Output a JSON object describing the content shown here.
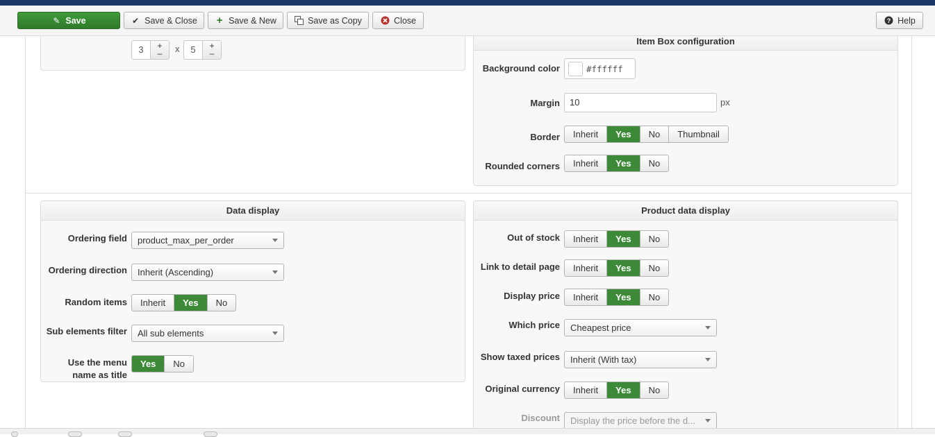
{
  "toolbar": {
    "save": "Save",
    "save_close": "Save & Close",
    "save_new": "Save & New",
    "save_copy": "Save as Copy",
    "close": "Close",
    "help": "Help"
  },
  "top_panel": {
    "rows_value": "3",
    "cols_value": "5",
    "times": "x",
    "plus": "+",
    "minus": "–"
  },
  "item_box": {
    "title": "Item Box configuration",
    "background_color_label": "Background color",
    "background_color_value": "#ffffff",
    "margin_label": "Margin",
    "margin_value": "10",
    "margin_unit": "px",
    "border_label": "Border",
    "border_options": [
      "Inherit",
      "Yes",
      "No",
      "Thumbnail"
    ],
    "border_selected": "Yes",
    "rounded_label": "Rounded corners",
    "rounded_options": [
      "Inherit",
      "Yes",
      "No"
    ],
    "rounded_selected": "Yes"
  },
  "data_display": {
    "title": "Data display",
    "ordering_field_label": "Ordering field",
    "ordering_field_value": "product_max_per_order",
    "ordering_direction_label": "Ordering direction",
    "ordering_direction_value": "Inherit (Ascending)",
    "random_items_label": "Random items",
    "random_items_options": [
      "Inherit",
      "Yes",
      "No"
    ],
    "sub_elements_label": "Sub elements filter",
    "sub_elements_value": "All sub elements",
    "menu_name_label": "Use the menu name as title",
    "menu_name_options": [
      "Yes",
      "No"
    ]
  },
  "product_display": {
    "title": "Product data display",
    "out_of_stock_label": "Out of stock",
    "link_detail_label": "Link to detail page",
    "display_price_label": "Display price",
    "which_price_label": "Which price",
    "which_price_value": "Cheapest price",
    "taxed_label": "Show taxed prices",
    "taxed_value": "Inherit (With tax)",
    "original_currency_label": "Original currency",
    "discount_label": "Discount",
    "discount_value": "Display the price before the d...",
    "tri_options": [
      "Inherit",
      "Yes",
      "No"
    ]
  },
  "colors": {
    "accent_green": "#3c8a38",
    "top_strip": "#1a3867"
  }
}
